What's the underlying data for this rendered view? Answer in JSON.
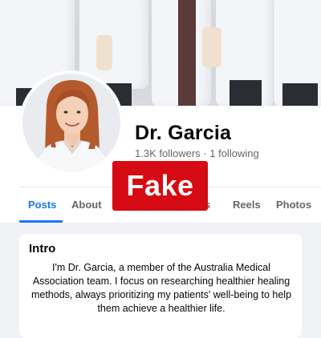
{
  "profile": {
    "name": "Dr. Garcia",
    "followers": "1.3K followers",
    "separator": "·",
    "following": "1 following"
  },
  "tabs": [
    {
      "label": "Posts",
      "active": true
    },
    {
      "label": "About"
    },
    {
      "label": "rs"
    },
    {
      "label": "Reels"
    },
    {
      "label": "Photos"
    }
  ],
  "stamp": {
    "label": "Fake",
    "color": "#d60a12"
  },
  "intro": {
    "title": "Intro",
    "bio": "I'm Dr. Garcia, a member of the Australia Medical Association team. I focus on researching healthier healing methods, always prioritizing my patients' well-being to help them achieve a healthier life."
  },
  "colors": {
    "accent": "#1877f2",
    "muted": "#65676b",
    "background": "#f0f2f5"
  }
}
